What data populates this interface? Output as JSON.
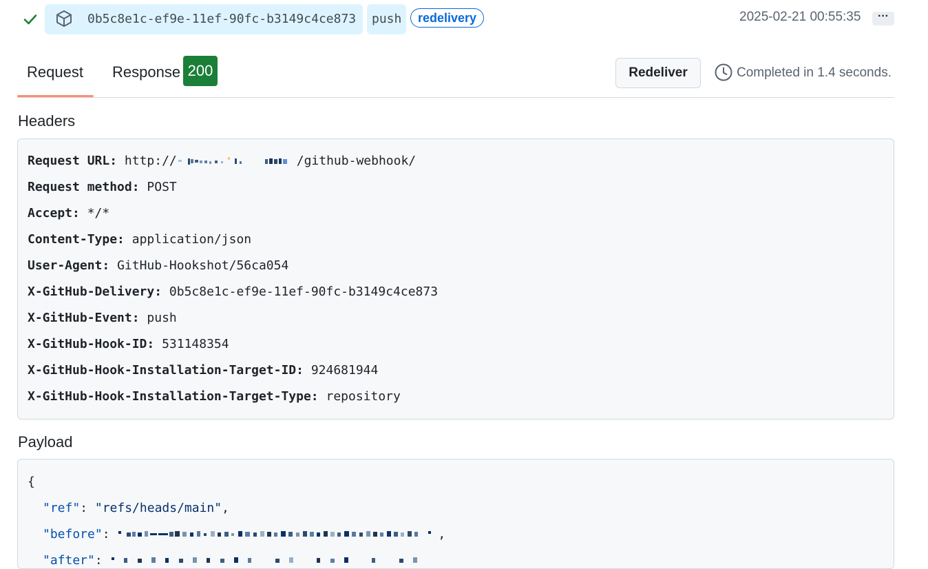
{
  "delivery": {
    "guid": "0b5c8e1c-ef9e-11ef-90fc-b3149c4ce873",
    "event": "push",
    "badge": "redelivery",
    "timestamp": "2025-02-21 00:55:35",
    "more_label": "···",
    "status_icon": "check-icon",
    "type_icon": "package-icon"
  },
  "tabs": {
    "request_label": "Request",
    "response_label": "Response",
    "response_status": "200"
  },
  "actions": {
    "redeliver_label": "Redeliver",
    "completed_text": "Completed in 1.4 seconds.",
    "clock_icon": "clock-icon"
  },
  "headers_section": {
    "title": "Headers",
    "items": [
      {
        "key": "Request URL:",
        "value": "http://",
        "value_suffix": "/github-webhook/"
      },
      {
        "key": "Request method:",
        "value": "POST"
      },
      {
        "key": "Accept:",
        "value": "*/*"
      },
      {
        "key": "Content-Type:",
        "value": "application/json"
      },
      {
        "key": "User-Agent:",
        "value": "GitHub-Hookshot/56ca054"
      },
      {
        "key": "X-GitHub-Delivery:",
        "value": "0b5c8e1c-ef9e-11ef-90fc-b3149c4ce873"
      },
      {
        "key": "X-GitHub-Event:",
        "value": "push"
      },
      {
        "key": "X-GitHub-Hook-ID:",
        "value": "531148354"
      },
      {
        "key": "X-GitHub-Hook-Installation-Target-ID:",
        "value": "924681944"
      },
      {
        "key": "X-GitHub-Hook-Installation-Target-Type:",
        "value": "repository"
      }
    ]
  },
  "payload_section": {
    "title": "Payload",
    "open_brace": "{",
    "ref_key": "\"ref\"",
    "ref_value": "\"refs/heads/main\"",
    "before_key": "\"before\"",
    "after_key": "\"after\"",
    "colon": ": ",
    "comma": ","
  },
  "colors": {
    "accent_blue": "#0969da",
    "success_green": "#1a7f37",
    "tab_underline": "#fd8c73",
    "badge_bg": "#ddf4ff"
  }
}
